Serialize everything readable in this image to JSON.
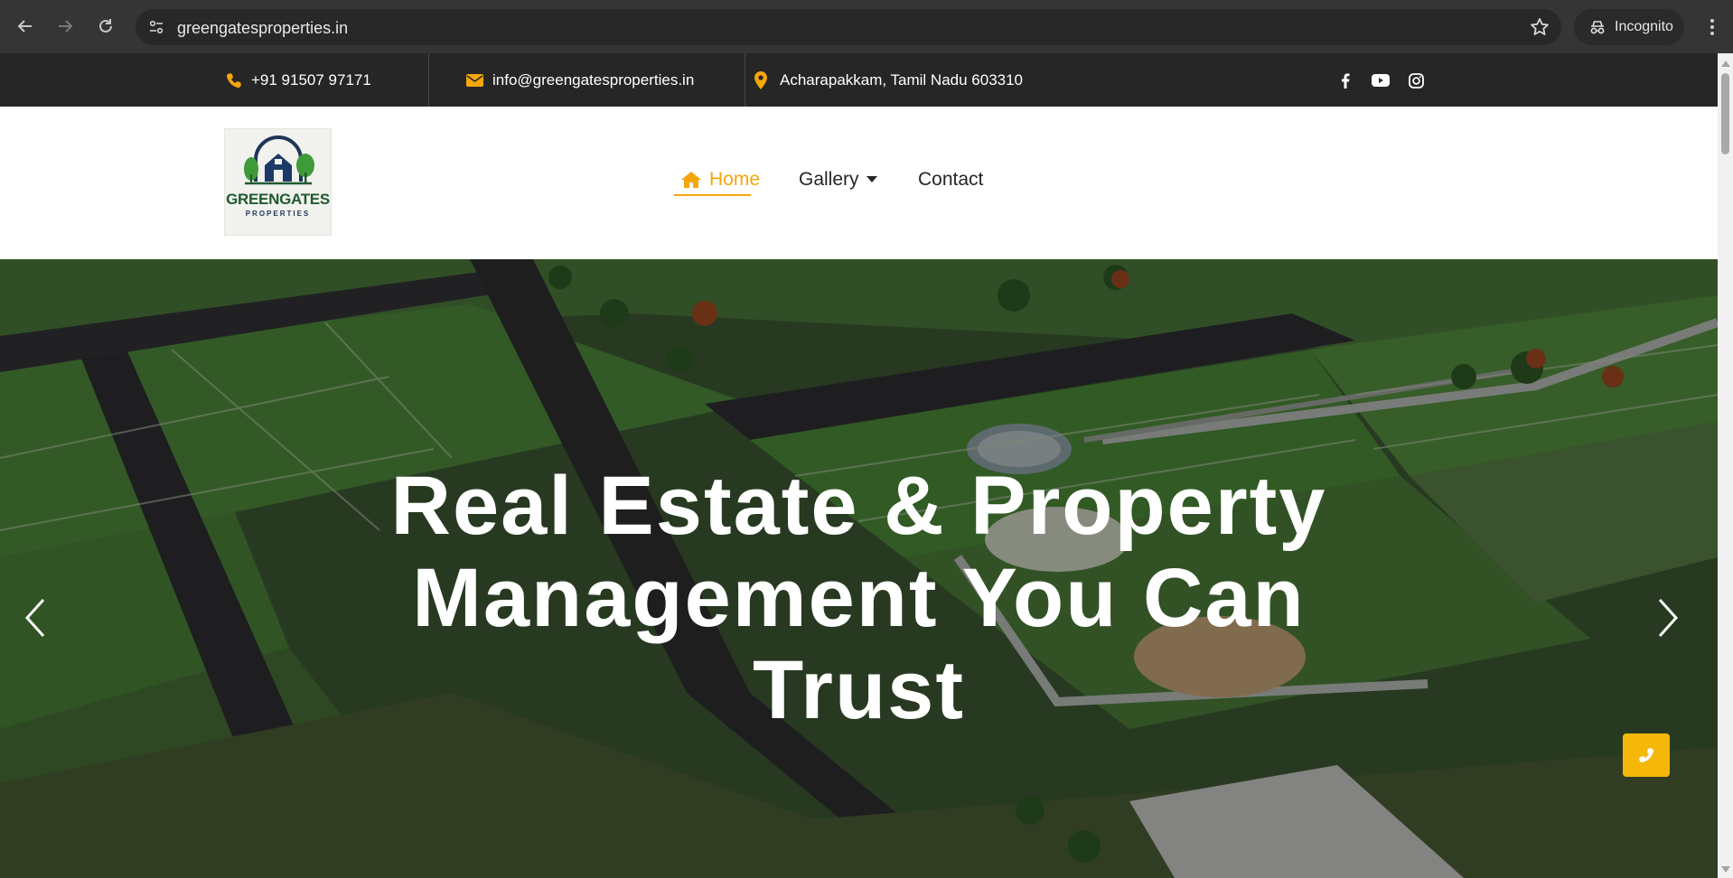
{
  "browser": {
    "url": "greengatesproperties.in",
    "profile_label": "Incognito",
    "icons": [
      "back-arrow-icon",
      "forward-arrow-icon",
      "reload-icon",
      "site-settings-icon",
      "star-icon",
      "incognito-icon",
      "kebab-menu-icon"
    ]
  },
  "topbar": {
    "phone": "+91 91507 97171",
    "email": "info@greengatesproperties.in",
    "address": "Acharapakkam, Tamil Nadu 603310",
    "social_icons": [
      "facebook-icon",
      "youtube-icon",
      "instagram-icon"
    ]
  },
  "header": {
    "logo": {
      "name": "GREENGATES",
      "sub": "PROPERTIES"
    },
    "nav": [
      {
        "label": "Home",
        "active": true,
        "icon": "home-icon"
      },
      {
        "label": "Gallery",
        "icon": "caret-down-icon"
      },
      {
        "label": "Contact"
      }
    ]
  },
  "hero": {
    "title_lines": [
      "Real Estate & Property",
      "Management You Can",
      "Trust"
    ],
    "icons": [
      "chevron-left-icon",
      "chevron-right-icon",
      "phone-icon"
    ]
  },
  "colors": {
    "accent": "#f5a60a",
    "topbar_bg": "#262626",
    "chrome_bg": "#353535",
    "call_button": "#f5b80a"
  }
}
